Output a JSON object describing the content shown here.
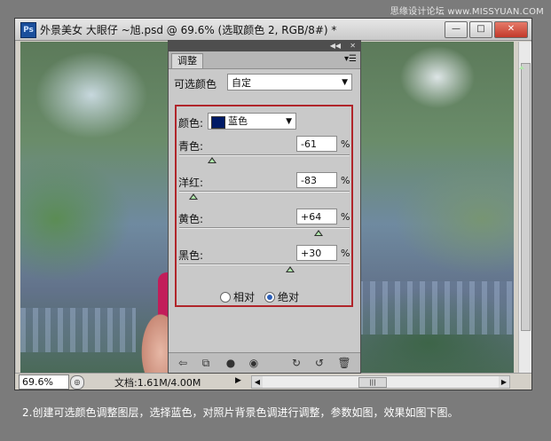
{
  "watermark": "思缘设计论坛 www.MISSYUAN.COM",
  "window": {
    "title": "外景美女 大眼仔 ~旭.psd @ 69.6% (选取颜色 2, RGB/8#) *",
    "app_icon": "Ps"
  },
  "status": {
    "zoom": "69.6%",
    "doc_info": "文档:1.61M/4.00M"
  },
  "panel": {
    "tab": "调整",
    "preset_label": "可选颜色",
    "preset_value": "自定",
    "color_label": "颜色:",
    "color_value": "蓝色",
    "color_swatch": "#001a66",
    "sliders": [
      {
        "label": "青色:",
        "value": "-61",
        "unit": "%",
        "level": -61
      },
      {
        "label": "洋红:",
        "value": "-83",
        "unit": "%",
        "level": -83
      },
      {
        "label": "黄色:",
        "value": "+64",
        "unit": "%",
        "level": 64
      },
      {
        "label": "黑色:",
        "value": "+30",
        "unit": "%",
        "level": 30
      }
    ],
    "method": {
      "relative": "相对",
      "absolute": "绝对",
      "selected": "absolute"
    }
  },
  "caption": "2.创建可选颜色调整图层，选择蓝色，对照片背景色调进行调整，参数如图，效果如图下图。",
  "colors": {
    "highlight_border": "#b0252a",
    "background": "#7b7b7b"
  }
}
